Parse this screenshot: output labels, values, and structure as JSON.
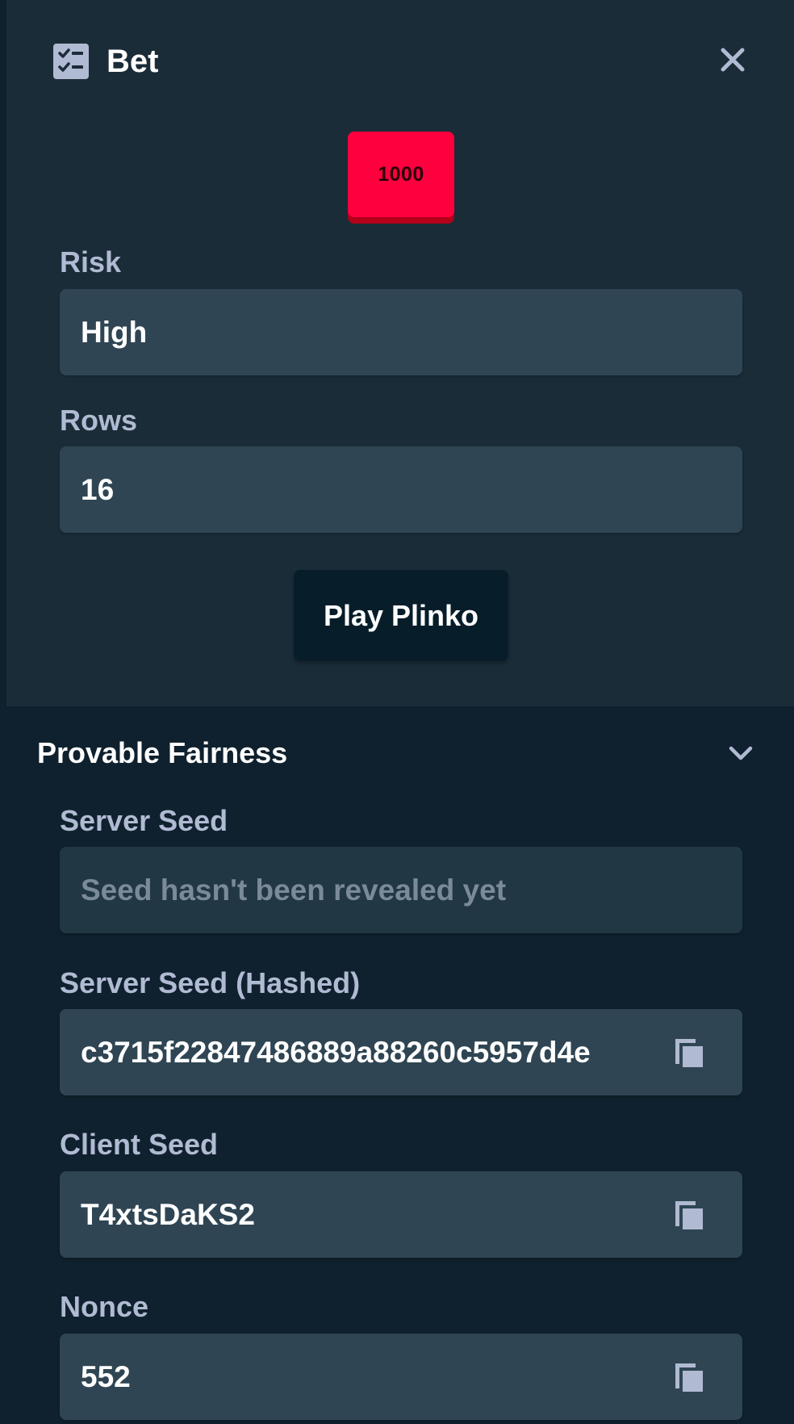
{
  "header": {
    "title": "Bet",
    "icon": "checklist-icon",
    "close_icon": "close-icon"
  },
  "chip": {
    "value": "1000",
    "color": "#ff003f"
  },
  "risk": {
    "label": "Risk",
    "value": "High"
  },
  "rows": {
    "label": "Rows",
    "value": "16"
  },
  "play_button": {
    "label": "Play Plinko"
  },
  "provable_fairness": {
    "title": "Provable Fairness",
    "toggle_icon": "chevron-down-icon",
    "server_seed": {
      "label": "Server Seed",
      "placeholder": "Seed hasn't been revealed yet"
    },
    "server_seed_hashed": {
      "label": "Server Seed (Hashed)",
      "value": "c3715f22847486889a88260c5957d4e"
    },
    "client_seed": {
      "label": "Client Seed",
      "value": "T4xtsDaKS2"
    },
    "nonce": {
      "label": "Nonce",
      "value": "552"
    },
    "copy_icon": "copy-icon"
  },
  "colors": {
    "panel_bg": "#1a2c38",
    "page_bg": "#0f212e",
    "field_bg": "#2f4553",
    "label": "#b1bad3",
    "accent_red": "#ff003f"
  }
}
